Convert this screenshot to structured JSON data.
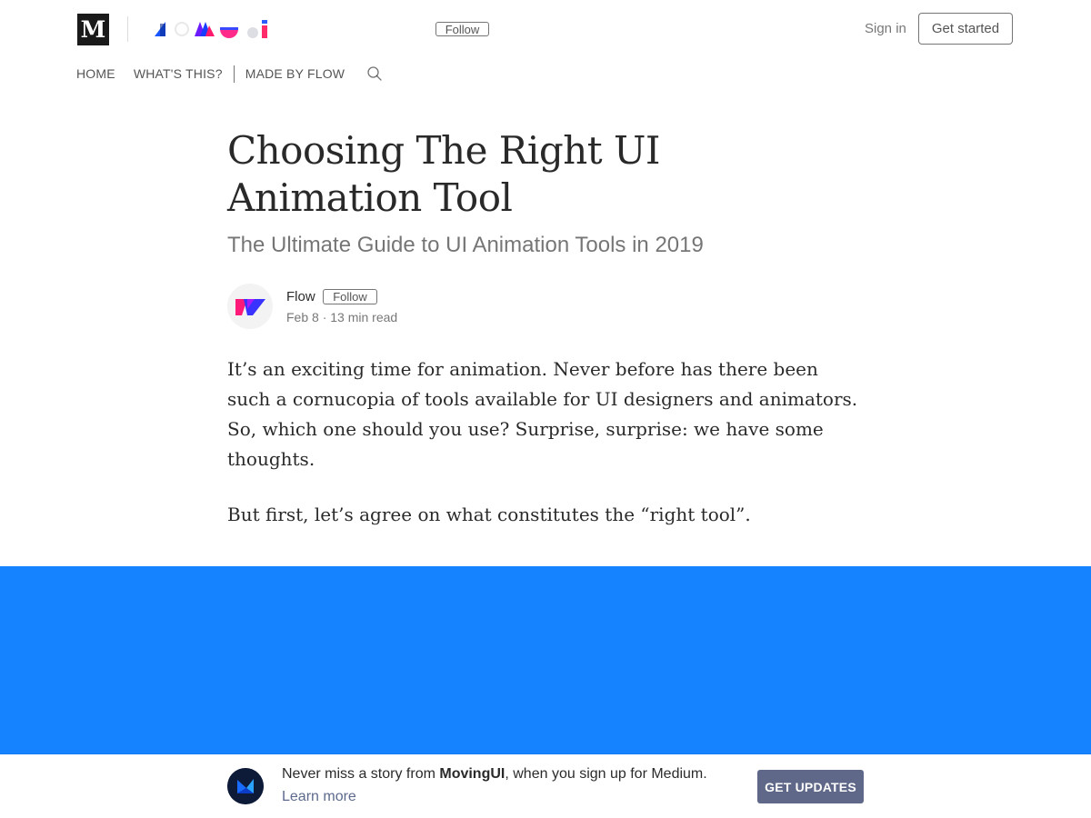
{
  "header": {
    "brand_logo_letter": "M",
    "publication_logo_name": "MovingUI logo",
    "follow_label": "Follow",
    "sign_in_label": "Sign in",
    "get_started_label": "Get started"
  },
  "nav": {
    "items": [
      {
        "label": "HOME"
      },
      {
        "label": "WHAT'S THIS?"
      },
      {
        "label": "MADE BY FLOW"
      }
    ],
    "search_icon": "search-icon"
  },
  "article": {
    "title": "Choosing The Right UI Animation Tool",
    "subtitle": "The Ultimate Guide to UI Animation Tools in 2019",
    "author": {
      "name": "Flow",
      "follow_label": "Follow",
      "date": "Feb 8",
      "separator": "·",
      "read_time": "13 min read"
    },
    "paragraphs": [
      "It’s an exciting time for animation. Never before has there been such a cornucopia of tools available for UI designers and animators. So, which one should you use? Surprise, surprise: we have some thoughts.",
      "But first, let’s agree on what constitutes the “right tool”."
    ]
  },
  "hero": {
    "color": "#1582ff"
  },
  "bottom_bar": {
    "text_before": "Never miss a story from ",
    "publication": "MovingUI",
    "text_after": ", when you sign up for Medium.",
    "learn_more": "Learn more",
    "cta_label": "GET UPDATES"
  },
  "colors": {
    "accent_blue": "#1582ff",
    "cta_gray": "#5f6888",
    "link_blue_gray": "#5d6a8e"
  }
}
